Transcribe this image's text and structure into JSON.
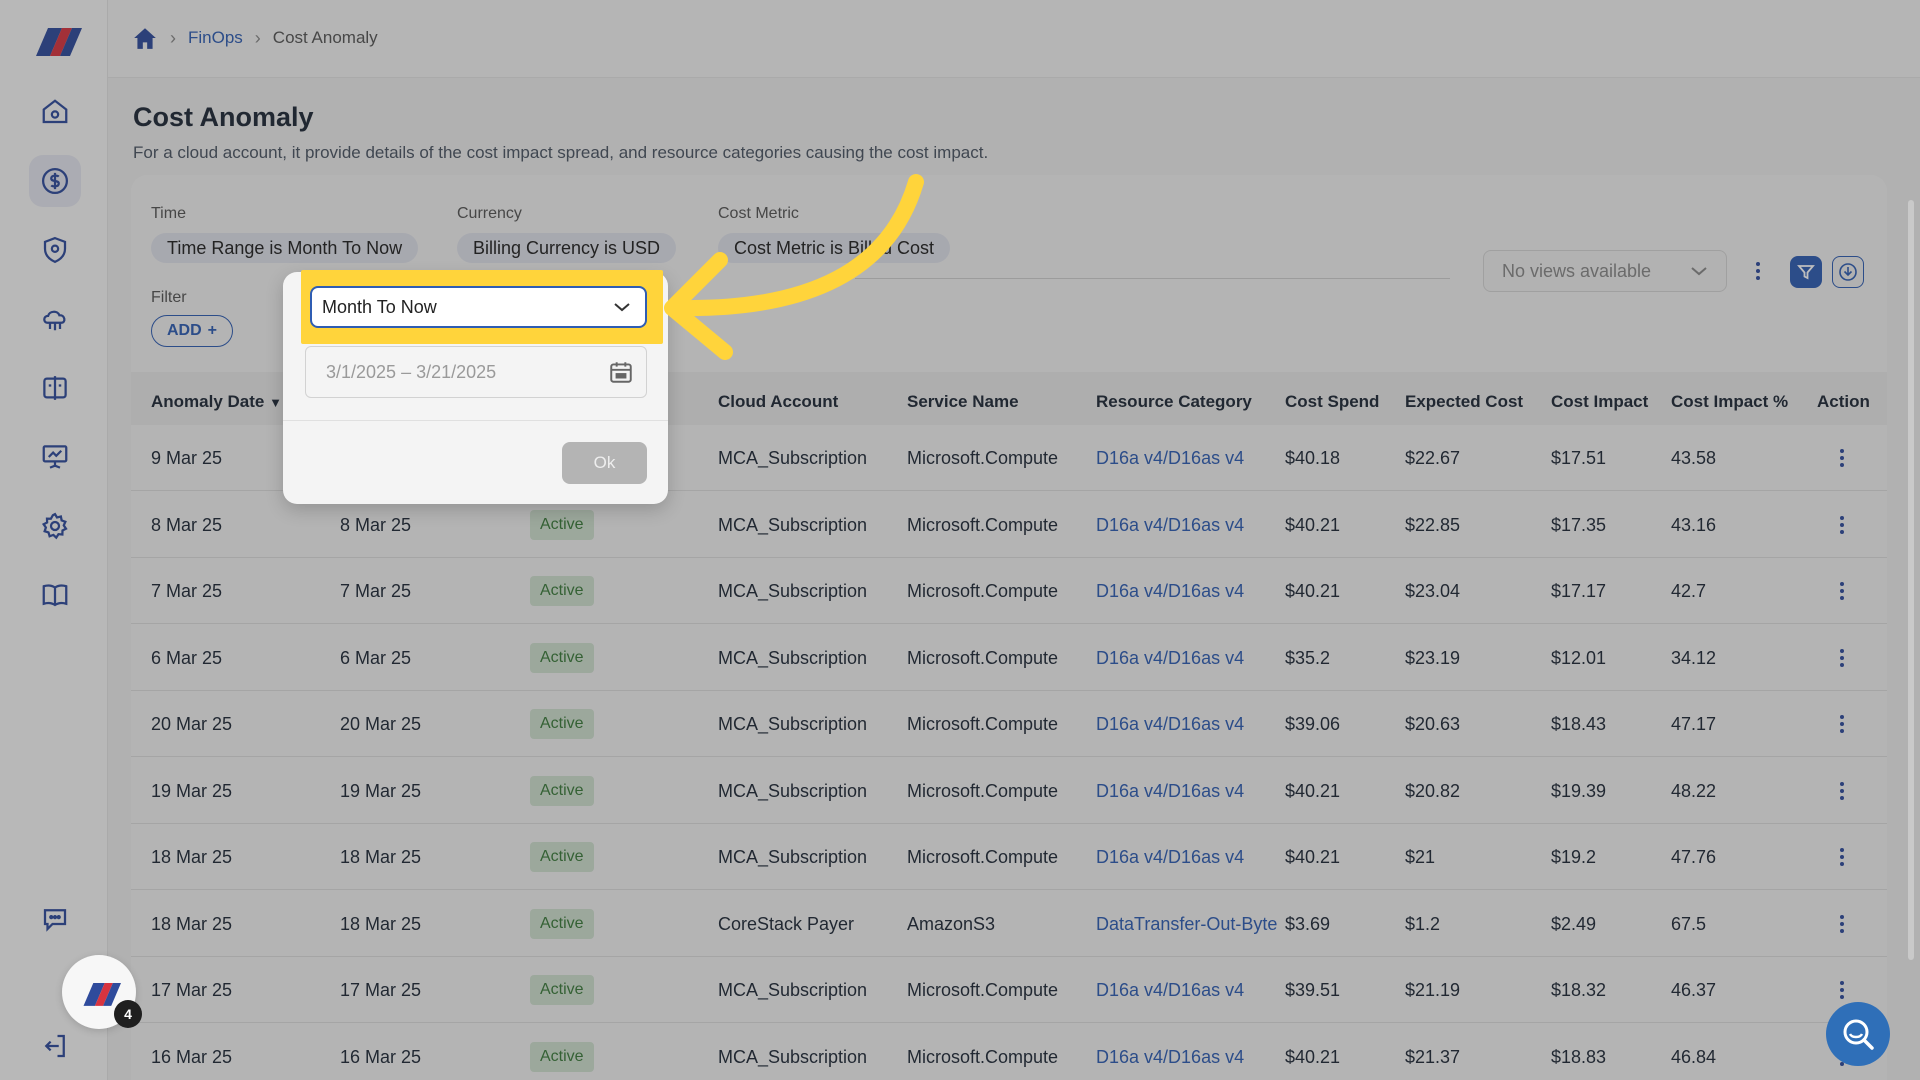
{
  "breadcrumb": {
    "home_icon": "home-icon",
    "items": [
      "FinOps",
      "Cost Anomaly"
    ]
  },
  "page": {
    "title": "Cost Anomaly",
    "description": "For a cloud account, it provide details of the cost impact spread, and resource categories causing the cost impact."
  },
  "filters": {
    "time_label": "Time",
    "time_chip": "Time Range is Month To Now",
    "currency_label": "Currency",
    "currency_chip": "Billing Currency is USD",
    "metric_label": "Cost Metric",
    "metric_chip": "Cost Metric is Billed Cost",
    "filter_label": "Filter",
    "add_label": "ADD",
    "add_icon": "+"
  },
  "views": {
    "placeholder": "No views available"
  },
  "popover": {
    "selected": "Month To Now",
    "date_range": "3/1/2025 – 3/21/2025",
    "ok_label": "Ok"
  },
  "table": {
    "columns": [
      "Anomaly Date",
      "Cloud Account",
      "Service Name",
      "Resource Category",
      "Cost Spend",
      "Expected Cost",
      "Cost Impact",
      "Cost Impact %",
      "Action"
    ],
    "rows": [
      {
        "date": "9 Mar 25",
        "date2": "",
        "status": "",
        "account": "MCA_Subscription",
        "service": "Microsoft.Compute",
        "category": "D16a v4/D16as v4",
        "spend": "$40.18",
        "expected": "$22.67",
        "impact": "$17.51",
        "pct": "43.58"
      },
      {
        "date": "8 Mar 25",
        "date2": "8 Mar 25",
        "status": "Active",
        "account": "MCA_Subscription",
        "service": "Microsoft.Compute",
        "category": "D16a v4/D16as v4",
        "spend": "$40.21",
        "expected": "$22.85",
        "impact": "$17.35",
        "pct": "43.16"
      },
      {
        "date": "7 Mar 25",
        "date2": "7 Mar 25",
        "status": "Active",
        "account": "MCA_Subscription",
        "service": "Microsoft.Compute",
        "category": "D16a v4/D16as v4",
        "spend": "$40.21",
        "expected": "$23.04",
        "impact": "$17.17",
        "pct": "42.7"
      },
      {
        "date": "6 Mar 25",
        "date2": "6 Mar 25",
        "status": "Active",
        "account": "MCA_Subscription",
        "service": "Microsoft.Compute",
        "category": "D16a v4/D16as v4",
        "spend": "$35.2",
        "expected": "$23.19",
        "impact": "$12.01",
        "pct": "34.12"
      },
      {
        "date": "20 Mar 25",
        "date2": "20 Mar 25",
        "status": "Active",
        "account": "MCA_Subscription",
        "service": "Microsoft.Compute",
        "category": "D16a v4/D16as v4",
        "spend": "$39.06",
        "expected": "$20.63",
        "impact": "$18.43",
        "pct": "47.17"
      },
      {
        "date": "19 Mar 25",
        "date2": "19 Mar 25",
        "status": "Active",
        "account": "MCA_Subscription",
        "service": "Microsoft.Compute",
        "category": "D16a v4/D16as v4",
        "spend": "$40.21",
        "expected": "$20.82",
        "impact": "$19.39",
        "pct": "48.22"
      },
      {
        "date": "18 Mar 25",
        "date2": "18 Mar 25",
        "status": "Active",
        "account": "MCA_Subscription",
        "service": "Microsoft.Compute",
        "category": "D16a v4/D16as v4",
        "spend": "$40.21",
        "expected": "$21",
        "impact": "$19.2",
        "pct": "47.76"
      },
      {
        "date": "18 Mar 25",
        "date2": "18 Mar 25",
        "status": "Active",
        "account": "CoreStack Payer",
        "service": "AmazonS3",
        "category": "DataTransfer-Out-Byte",
        "spend": "$3.69",
        "expected": "$1.2",
        "impact": "$2.49",
        "pct": "67.5"
      },
      {
        "date": "17 Mar 25",
        "date2": "17 Mar 25",
        "status": "Active",
        "account": "MCA_Subscription",
        "service": "Microsoft.Compute",
        "category": "D16a v4/D16as v4",
        "spend": "$39.51",
        "expected": "$21.19",
        "impact": "$18.32",
        "pct": "46.37"
      },
      {
        "date": "16 Mar 25",
        "date2": "16 Mar 25",
        "status": "Active",
        "account": "MCA_Subscription",
        "service": "Microsoft.Compute",
        "category": "D16a v4/D16as v4",
        "spend": "$40.21",
        "expected": "$21.37",
        "impact": "$18.83",
        "pct": "46.84"
      }
    ]
  },
  "notification_count": "4",
  "colors": {
    "accent": "#2f5db3",
    "highlight": "#ffd43b",
    "active_badge_bg": "#cfe0cf",
    "active_badge_text": "#3a7a3a"
  }
}
